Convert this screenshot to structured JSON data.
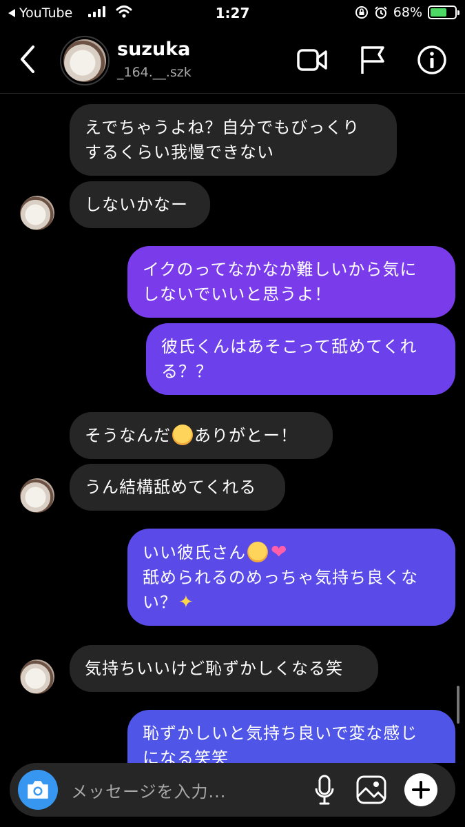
{
  "status_bar": {
    "back_app": "YouTube",
    "time": "1:27",
    "battery": "68%",
    "battery_level": 0.68
  },
  "header": {
    "name": "suzuka",
    "handle": "_164.__.szk",
    "back_icon": "chevron-left-icon",
    "actions": [
      "video-call-icon",
      "flag-icon",
      "info-icon"
    ]
  },
  "messages": [
    {
      "from": "them",
      "lines": [
        "えでちゃうよね？自分でもびっくり",
        "するくらい我慢できない"
      ]
    },
    {
      "from": "them",
      "lines": [
        "しないかなー"
      ]
    },
    {
      "from": "me",
      "lines": [
        "イクのってなかなか難しいから気に",
        "しないでいいと思うよ！"
      ]
    },
    {
      "from": "me",
      "lines": [
        "彼氏くんはあそこって舐めてくれ",
        "る？？"
      ]
    },
    {
      "from": "them",
      "before": "そうなんだ",
      "emoji": "crying-face",
      "after": "ありがとー！"
    },
    {
      "from": "them",
      "lines": [
        "うん結構舐めてくれる"
      ]
    },
    {
      "from": "me",
      "line1_text": "いい彼氏さん",
      "line1_emojis": [
        "pleading-face",
        "sparkling-heart"
      ],
      "line2": "舐められるのめっちゃ気持ち良くな",
      "line3_text": "い？",
      "line3_emoji": "sparkles"
    },
    {
      "from": "them",
      "lines": [
        "気持ちいいけど恥ずかしくなる笑"
      ]
    },
    {
      "from": "me",
      "lines": [
        "恥ずかしいと気持ち良いで変な感じ",
        "になる笑笑"
      ]
    }
  ],
  "composer": {
    "placeholder": "メッセージを入力...",
    "icons": [
      "camera-icon",
      "microphone-icon",
      "gallery-icon",
      "plus-icon"
    ]
  },
  "colors": {
    "background": "#000000",
    "incoming_bubble": "#262626",
    "outgoing_top": "#7a3cea",
    "outgoing_bottom": "#4f55e6",
    "camera_button": "#3797f0"
  }
}
